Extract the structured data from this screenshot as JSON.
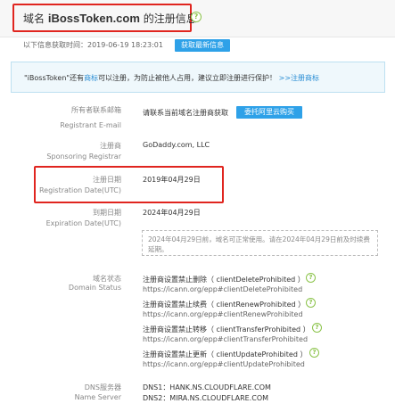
{
  "header": {
    "title_prefix": "域名",
    "domain": "iBossToken.com",
    "title_suffix": "的注册信息",
    "help_icon": "question-circle-icon"
  },
  "update": {
    "label": "以下信息获取时间：",
    "time": "2019-06-19 18:23:01",
    "button": "获取最新信息"
  },
  "notice": {
    "quote_name": "\"iBossToken\"",
    "part1": "还有",
    "link_trademark": "商标",
    "part2": "可以注册，为防止被他人占用，建议立即注册进行保护！",
    "link_register": ">>注册商标"
  },
  "fields": {
    "email": {
      "label_cn": "所有者联系邮箱",
      "label_en": "Registrant E-mail",
      "value": "请联系当前域名注册商获取",
      "button": "委托阿里云购买"
    },
    "registrar": {
      "label_cn": "注册商",
      "label_en": "Sponsoring Registrar",
      "value": "GoDaddy.com, LLC"
    },
    "reg_date": {
      "label_cn": "注册日期",
      "label_en": "Registration Date(UTC)",
      "value": "2019年04月29日"
    },
    "exp_date": {
      "label_cn": "到期日期",
      "label_en": "Expiration Date(UTC)",
      "value": "2024年04月29日",
      "note_line1": "2024年04月29日前，域名可正常使用。请在2024年04月29日前及时续费",
      "note_line2": "延期。"
    },
    "status": {
      "label_cn": "域名状态",
      "label_en": "Domain Status",
      "items": [
        {
          "title": "注册商设置禁止删除（ clientDeleteProhibited ）",
          "url": "https://icann.org/epp#clientDeleteProhibited"
        },
        {
          "title": "注册商设置禁止续费（ clientRenewProhibited ）",
          "url": "https://icann.org/epp#clientRenewProhibited"
        },
        {
          "title": "注册商设置禁止转移（ clientTransferProhibited ）",
          "url": "https://icann.org/epp#clientTransferProhibited"
        },
        {
          "title": "注册商设置禁止更新（ clientUpdateProhibited ）",
          "url": "https://icann.org/epp#clientUpdateProhibited"
        }
      ]
    },
    "dns": {
      "label_cn": "DNS服务器",
      "label_en": "Name Server",
      "values": [
        "DNS1：HANK.NS.CLOUDFLARE.COM",
        "DNS2：MIRA.NS.CLOUDFLARE.COM"
      ]
    }
  },
  "colors": {
    "accent": "#2ea1e8",
    "highlight": "#e0251f",
    "help": "#8bc34a",
    "link": "#2a8dd4"
  }
}
